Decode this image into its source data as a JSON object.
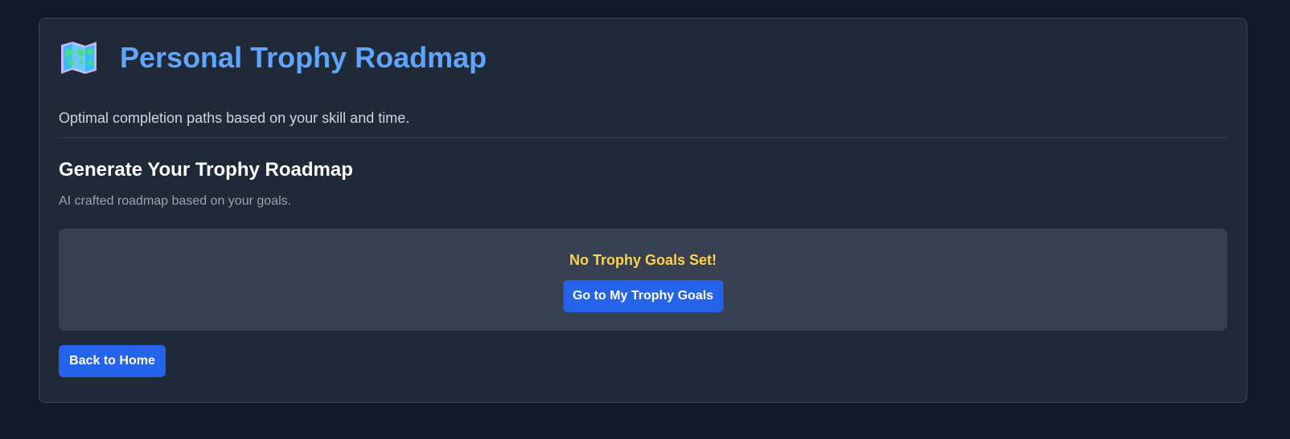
{
  "header": {
    "icon": "world-map-icon",
    "title": "Personal Trophy Roadmap",
    "subtitle": "Optimal completion paths based on your skill and time."
  },
  "section": {
    "title": "Generate Your Trophy Roadmap",
    "description": "AI crafted roadmap based on your goals."
  },
  "empty_state": {
    "message": "No Trophy Goals Set!",
    "button_label": "Go to My Trophy Goals"
  },
  "footer": {
    "back_label": "Back to Home"
  },
  "colors": {
    "background": "#111827",
    "card": "#1f2937",
    "title": "#60a5fa",
    "warning": "#fcd34d",
    "button": "#2563eb"
  }
}
